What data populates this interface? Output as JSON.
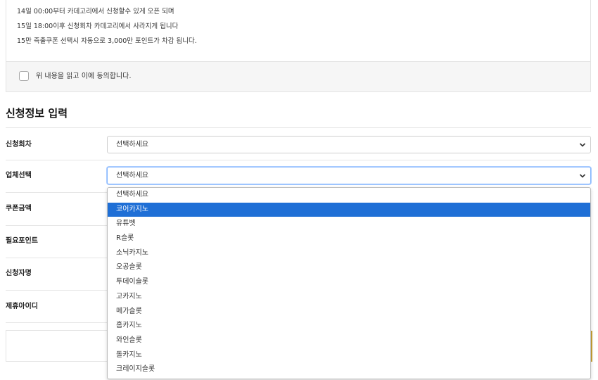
{
  "notice": {
    "lines": [
      "14일 00:00부터 카데고리에서 신청할수 있게 오픈 되며",
      "15일 18:00이후 신청회차 카데고리에서 사라지게 됩니다",
      "15만 즉출쿠폰 선택시 자동으로 3,000만 포인트가 차감 됩니다."
    ],
    "agree_label": "위 내용을 읽고 이에 동의합니다.",
    "agree_checked": false
  },
  "section_title": "신청정보 입력",
  "form": {
    "rows": [
      {
        "label": "신청회차",
        "select_value": "선택하세요"
      },
      {
        "label": "업체선택",
        "select_value": "선택하세요"
      },
      {
        "label": "쿠폰금액"
      },
      {
        "label": "필요포인트"
      },
      {
        "label": "신청자명"
      },
      {
        "label": "제휴아이디"
      }
    ]
  },
  "dropdown": {
    "options": [
      "선택하세요",
      "코어카지노",
      "유튜벳",
      "R슬롯",
      "소닉카지노",
      "오공슬롯",
      "투데이슬롯",
      "고카지노",
      "메가슬롯",
      "홈카지노",
      "와인슬롯",
      "돌카지노",
      "크레이지슬롯"
    ],
    "highlighted": "코어카지노"
  },
  "colors": {
    "highlight": "#1f6fd6",
    "focus_border": "#86b7fe",
    "accent_edge": "#c9a236"
  }
}
